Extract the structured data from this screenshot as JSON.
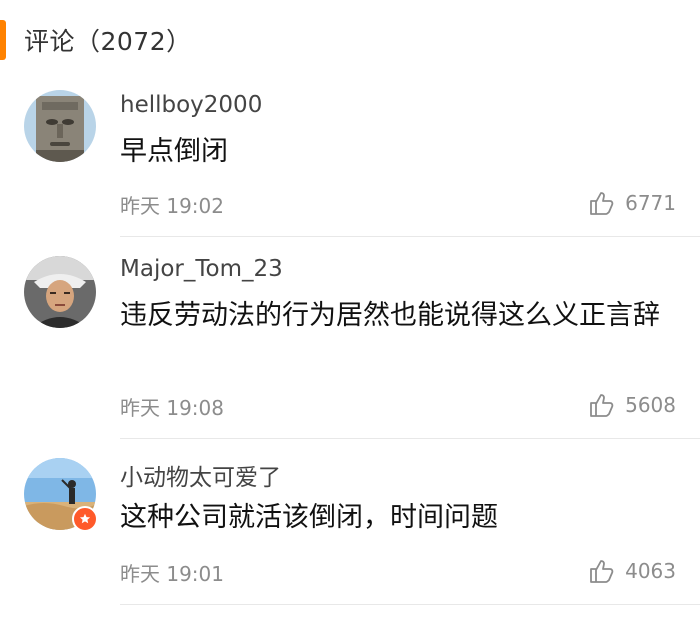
{
  "header": {
    "title": "评论（2072）"
  },
  "comments": [
    {
      "username": "hellboy2000",
      "text": "早点倒闭",
      "time": "昨天 19:02",
      "likes": "6771",
      "avatar_icon": "stone-face-avatar-icon"
    },
    {
      "username": "Major_Tom_23",
      "text": "违反劳动法的行为居然也能说得这么义正言辞",
      "time": "昨天 19:08",
      "likes": "5608",
      "avatar_icon": "portrait-avatar-icon"
    },
    {
      "username": "小动物太可爱了",
      "text": "这种公司就活该倒闭，时间问题",
      "time": "昨天 19:01",
      "likes": "4063",
      "avatar_icon": "desert-avatar-icon",
      "badge_icon": "star-badge-icon"
    }
  ],
  "colors": {
    "accent": "#ff8200",
    "badge": "#ff5a2a"
  }
}
